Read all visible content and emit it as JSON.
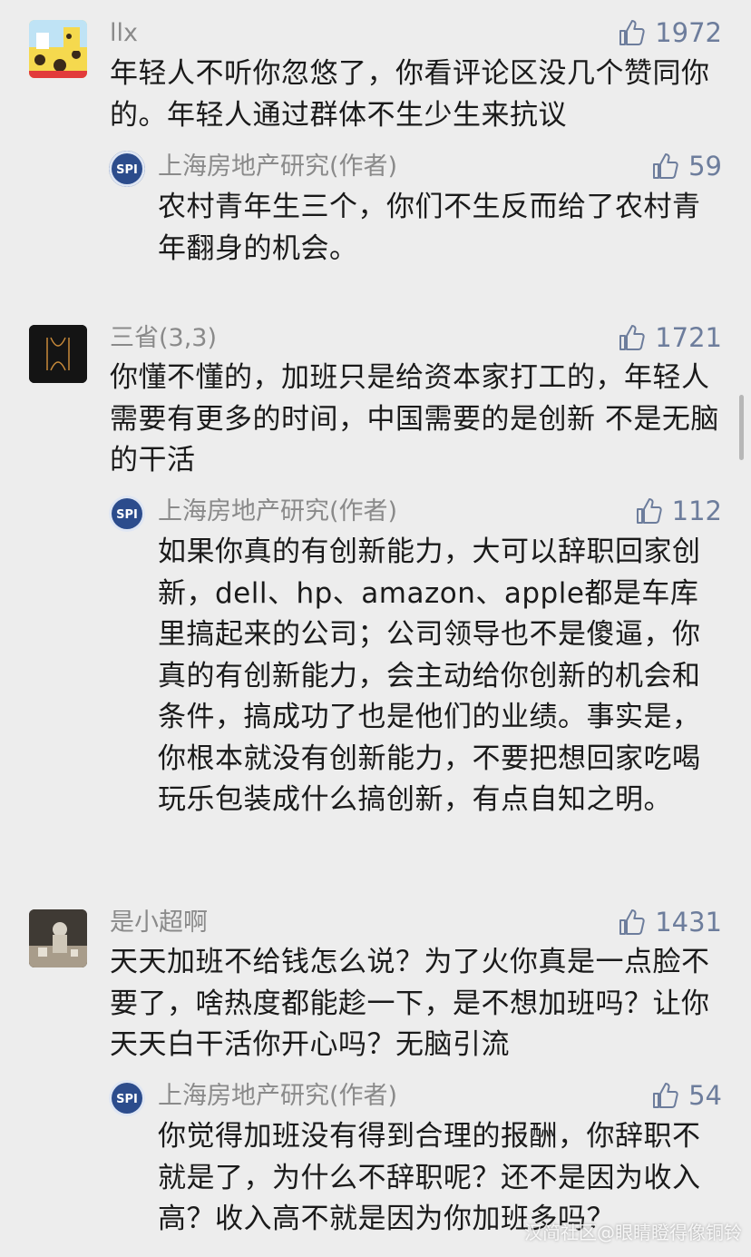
{
  "comments": [
    {
      "name": "llx",
      "likes": "1972",
      "text": "年轻人不听你忽悠了，你看评论区没几个赞同你的。年轻人通过群体不生少生来抗议",
      "reply": {
        "name": "上海房地产研究(作者)",
        "likes": "59",
        "avatar_label": "SPI",
        "text": "农村青年生三个，你们不生反而给了农村青年翻身的机会。"
      }
    },
    {
      "name": "三省(3,3)",
      "likes": "1721",
      "text": "你懂不懂的，加班只是给资本家打工的，年轻人需要有更多的时间，中国需要的是创新 不是无脑的干活",
      "reply": {
        "name": "上海房地产研究(作者)",
        "likes": "112",
        "avatar_label": "SPI",
        "text": "如果你真的有创新能力，大可以辞职回家创新，dell、hp、amazon、apple都是车库里搞起来的公司；公司领导也不是傻逼，你真的有创新能力，会主动给你创新的机会和条件，搞成功了也是他们的业绩。事实是，你根本就没有创新能力，不要把想回家吃喝玩乐包装成什么搞创新，有点自知之明。"
      }
    },
    {
      "name": "是小超啊",
      "likes": "1431",
      "text": "天天加班不给钱怎么说？为了火你真是一点脸不要了，啥热度都能趁一下，是不想加班吗？让你天天白干活你开心吗？无脑引流",
      "reply": {
        "name": "上海房地产研究(作者)",
        "likes": "54",
        "avatar_label": "SPI",
        "text": "你觉得加班没有得到合理的报酬，你辞职不就是了，为什么不辞职呢？还不是因为收入高？收入高不就是因为你加班多吗？"
      }
    }
  ],
  "watermark": "汉简社区@眼睛瞪得像铜铃",
  "colors": {
    "background": "#ededed",
    "like": "#6d7d9c",
    "name": "#8a8a8a"
  }
}
